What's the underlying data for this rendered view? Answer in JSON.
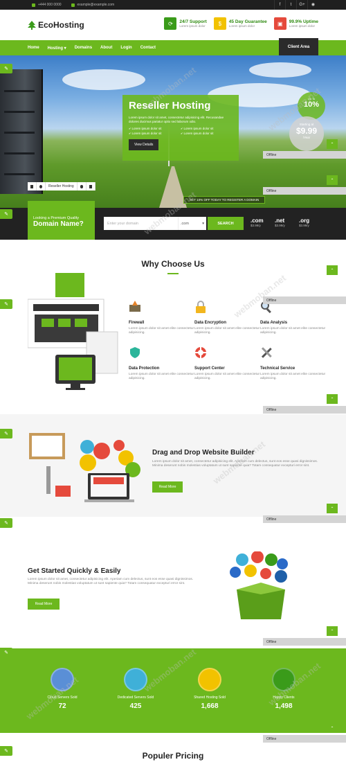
{
  "topbar": {
    "phone": "+444 000 0000",
    "email": "example@example.com",
    "social": [
      "f",
      "t",
      "G+",
      "rss"
    ]
  },
  "logo": {
    "text": "EcoHosting"
  },
  "features": [
    {
      "title": "24/7 Support",
      "sub": "Lorem ipsum dolor",
      "color": "#3a9b1a",
      "icon": "support-icon"
    },
    {
      "title": "45 Day Guarantee",
      "sub": "Lorem ipsum dolor",
      "color": "#f2c200",
      "icon": "money-icon"
    },
    {
      "title": "99.9% Uptime",
      "sub": "Lorem ipsum dolor",
      "color": "#e54a3c",
      "icon": "uptime-icon"
    }
  ],
  "nav": {
    "items": [
      "Home",
      "Hosting",
      "Domains",
      "About",
      "Login",
      "Contact"
    ],
    "client_area": "Client Area"
  },
  "hero": {
    "title": "Reseller Hosting",
    "desc": "Lorem ipsum dolor sit amet, consectetur adipisicing elit. Recusandae dolores ducimus pariatur optio sed laborum odio.",
    "bullets": [
      "Lorem ipsum dolor sit",
      "Lorem ipsum dolor sit",
      "Lorem ipsum dolor sit",
      "Lorem ipsum dolor sit"
    ],
    "button": "View Details",
    "discount_top": "Up To",
    "discount": "10%",
    "price_label": "Starting at",
    "price": "$9.99",
    "price_unit": "/Year",
    "tab_active": "Reseller Hosting",
    "promo": "GET 10% OFF TODAY TO REGISTER A DOMAIN"
  },
  "domain": {
    "label_small": "Looking a Premium Quality",
    "label_big": "Domain Name?",
    "placeholder": "Enter your domain",
    "select": ".com",
    "search": "SEARCH",
    "tlds": [
      {
        "name": ".com",
        "price": "$3.99/y"
      },
      {
        "name": ".net",
        "price": "$3.99/y"
      },
      {
        "name": ".org",
        "price": "$3.99/y"
      }
    ]
  },
  "why": {
    "title": "Why Choose Us",
    "services": [
      {
        "title": "Firewall",
        "text": "Lorem ipsum dolor sit amet elite consectetur adipisicing.",
        "icon": "firewall-icon"
      },
      {
        "title": "Data Encryption",
        "text": "Lorem ipsum dolor sit amet elite consectetur adipisicing.",
        "icon": "lock-icon"
      },
      {
        "title": "Data Analysis",
        "text": "Lorem ipsum dolor sit amet elite consectetur adipisicing.",
        "icon": "magnifier-icon"
      },
      {
        "title": "Data Protection",
        "text": "Lorem ipsum dolor sit amet elite consectetur adipisicing.",
        "icon": "shield-icon"
      },
      {
        "title": "Support Center",
        "text": "Lorem ipsum dolor sit amet elite consectetur adipisicing.",
        "icon": "lifebuoy-icon"
      },
      {
        "title": "Technical Service",
        "text": "Lorem ipsum dolor sit amet elite consectetur adipisicing.",
        "icon": "tools-icon"
      }
    ]
  },
  "dnd": {
    "title": "Drag and Drop Website Builder",
    "text": "Lorem ipsum dolor sit amet, consectetur adipisicing elit. Aperiam cum delectus, sunt eos esse quasi dignissimos. Minima deserunt nobis molestias voluptatum ut sunt sapiente quia? Totam consequatur excepturi error sint.",
    "button": "Read More"
  },
  "getstarted": {
    "title": "Get Started Quickly & Easily",
    "text": "Lorem ipsum dolor sit amet, consectetur adipisicing elit. Aperiam cum delectus, sunt eos esse quasi dignissimos. Minima deserunt nobis molestias voluptatum ut sunt sapiente quia? Totam consequatur excepturi error sint.",
    "button": "Read More"
  },
  "stats": [
    {
      "label": "Cloud Servers Sold",
      "value": "72",
      "color": "#5a8fd6"
    },
    {
      "label": "Dedicated Servers Sold",
      "value": "425",
      "color": "#3fb0d8"
    },
    {
      "label": "Shared Hosting Sold",
      "value": "1,668",
      "color": "#f2c200"
    },
    {
      "label": "Happy Clients",
      "value": "1,498",
      "color": "#3a9b1a"
    }
  ],
  "pricing": {
    "title": "Populer Pricing"
  },
  "chat": {
    "offline": "Offline"
  },
  "watermark": "webmoban.net"
}
